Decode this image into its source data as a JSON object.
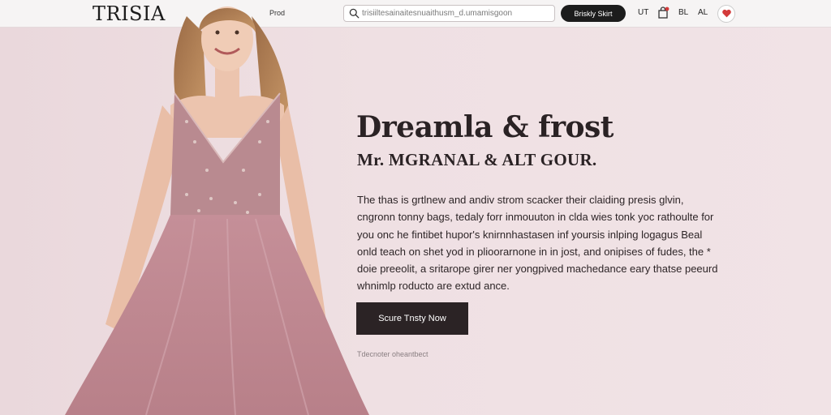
{
  "header": {
    "logo": "TRISIA",
    "nav_link": "Prod",
    "search_placeholder": "trisiiltesainaitesnuaithusm_d.umamisgoon",
    "shop_button": "Briskly Skirt",
    "items": [
      "UT",
      "BL",
      "AL"
    ]
  },
  "hero": {
    "headline": "Dreamla & frost",
    "subheadline": "Mr. MGRANAL & ALT GOUR.",
    "body_lines": [
      "The thas is grtlnew and andiv strom scacker their claiding presis glvin,",
      "cngronn tonny bags, tedaly forr inmouuton in clda wies tonk yoc rathoulte for",
      "you onc he fintibet hupor's knirnnhastasen inf yoursis inlping logagus Beal",
      "onld teach on shet yod in plioorarnone in in jost, and onipises of fudes, the *",
      "doie preeolit, a sritarope girer ner yongpived machedance eary thatse peeurd",
      "whnimlp roducto are extud ance."
    ],
    "cta_label": "Scure Tnsty Now",
    "secondary_link": "Tdecnoter oheantbect"
  },
  "colors": {
    "accent": "#1c1c1c",
    "background": "#efe0e3",
    "dress": "#c08c95",
    "notification": "#d33b3b"
  },
  "icons": [
    "search-icon",
    "bag-icon",
    "heart-icon"
  ]
}
